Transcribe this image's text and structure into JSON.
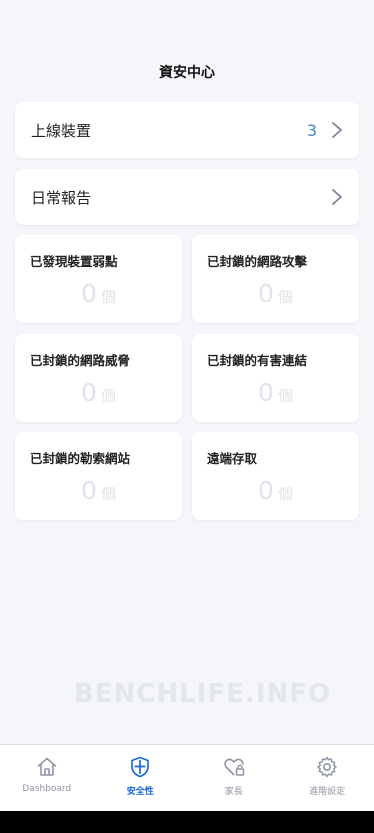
{
  "page": {
    "title": "資安中心"
  },
  "rows": [
    {
      "label": "上線裝置",
      "count": "3"
    },
    {
      "label": "日常報告",
      "count": ""
    }
  ],
  "stats": [
    {
      "label": "已發現裝置弱點",
      "value": "0",
      "unit": "個"
    },
    {
      "label": "已封鎖的網路攻擊",
      "value": "0",
      "unit": "個"
    },
    {
      "label": "已封鎖的網路威脅",
      "value": "0",
      "unit": "個"
    },
    {
      "label": "已封鎖的有害連結",
      "value": "0",
      "unit": "個"
    },
    {
      "label": "已封鎖的勒索網站",
      "value": "0",
      "unit": "個"
    },
    {
      "label": "遠端存取",
      "value": "0",
      "unit": "個"
    }
  ],
  "watermark": {
    "text": "BENCHLIFE.INFO"
  },
  "tabs": [
    {
      "label": "Dashboard",
      "icon": "home-icon",
      "active": false
    },
    {
      "label": "安全性",
      "icon": "shield-icon",
      "active": true
    },
    {
      "label": "家長",
      "icon": "heart-lock-icon",
      "active": false
    },
    {
      "label": "進階設定",
      "icon": "gear-icon",
      "active": false
    }
  ],
  "colors": {
    "accent": "#1a6ad8",
    "count": "#4a86c8",
    "muted": "#dfe3ea",
    "background": "#f4f6fa"
  }
}
